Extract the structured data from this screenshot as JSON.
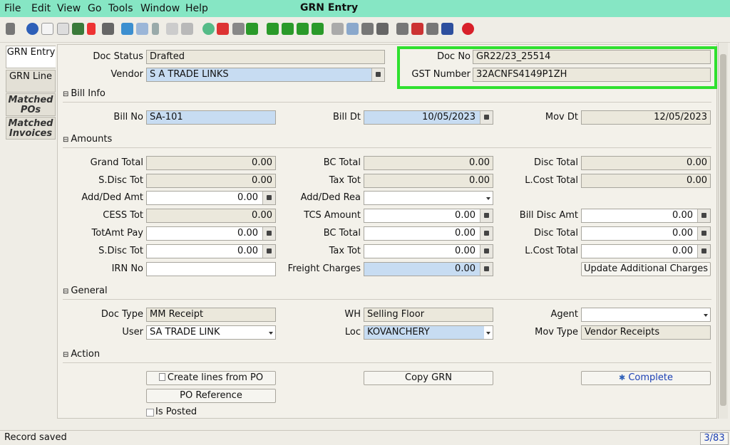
{
  "window": {
    "title": "GRN Entry"
  },
  "menu": [
    "File",
    "Edit",
    "View",
    "Go",
    "Tools",
    "Window",
    "Help"
  ],
  "tabs": [
    "GRN Entry",
    "GRN Line",
    "Matched POs",
    "Matched Invoices"
  ],
  "header": {
    "doc_status_label": "Doc Status",
    "doc_status": "Drafted",
    "vendor_label": "Vendor",
    "vendor": "S A TRADE LINKS",
    "doc_no_label": "Doc No",
    "doc_no": "GR22/23_25514",
    "gst_label": "GST Number",
    "gst": "32ACNFS4149P1ZH"
  },
  "bill_info": {
    "title": "Bill Info",
    "bill_no_label": "Bill No",
    "bill_no": "SA-101",
    "bill_dt_label": "Bill Dt",
    "bill_dt": "10/05/2023",
    "mov_dt_label": "Mov Dt",
    "mov_dt": "12/05/2023"
  },
  "amounts": {
    "title": "Amounts",
    "grand_total_label": "Grand Total",
    "grand_total": "0.00",
    "bc_total_label": "BC Total",
    "bc_total": "0.00",
    "disc_total_label": "Disc Total",
    "disc_total": "0.00",
    "sdisc_tot_label": "S.Disc Tot",
    "sdisc_tot": "0.00",
    "tax_tot_label": "Tax Tot",
    "tax_tot": "0.00",
    "lcost_total_label": "L.Cost Total",
    "lcost_total": "0.00",
    "add_ded_amt_label": "Add/Ded Amt",
    "add_ded_amt": "0.00",
    "add_ded_rea_label": "Add/Ded Rea",
    "add_ded_rea": "",
    "cess_tot_label": "CESS Tot",
    "cess_tot": "0.00",
    "tcs_amount_label": "TCS Amount",
    "tcs_amount": "0.00",
    "bill_disc_amt_label": "Bill Disc Amt",
    "bill_disc_amt": "0.00",
    "totamt_pay_label": "TotAmt Pay",
    "totamt_pay": "0.00",
    "bc_total2_label": "BC Total",
    "bc_total2": "0.00",
    "disc_total2_label": "Disc Total",
    "disc_total2": "0.00",
    "sdisc_tot2_label": "S.Disc Tot",
    "sdisc_tot2": "0.00",
    "tax_tot2_label": "Tax Tot",
    "tax_tot2": "0.00",
    "lcost_total2_label": "L.Cost Total",
    "lcost_total2": "0.00",
    "irn_no_label": "IRN No",
    "irn_no": "",
    "freight_label": "Freight Charges",
    "freight": "0.00",
    "update_btn": "Update Additional Charges"
  },
  "general": {
    "title": "General",
    "doc_type_label": "Doc Type",
    "doc_type": "MM Receipt",
    "wh_label": "WH",
    "wh": "Selling Floor",
    "agent_label": "Agent",
    "agent": "",
    "user_label": "User",
    "user": "SA TRADE LINK",
    "loc_label": "Loc",
    "loc": "KOVANCHERY",
    "mov_type_label": "Mov Type",
    "mov_type": "Vendor Receipts"
  },
  "action": {
    "title": "Action",
    "create_lines": "Create lines from PO",
    "copy_grn": "Copy GRN",
    "complete": "Complete",
    "po_reference": "PO Reference",
    "is_posted": "Is Posted"
  },
  "status": {
    "message": "Record saved",
    "counter": "3/83"
  },
  "colors": {
    "menubar": "#86e6c4",
    "highlight": "#2fe02f",
    "blue_field": "#c7dcf2"
  }
}
